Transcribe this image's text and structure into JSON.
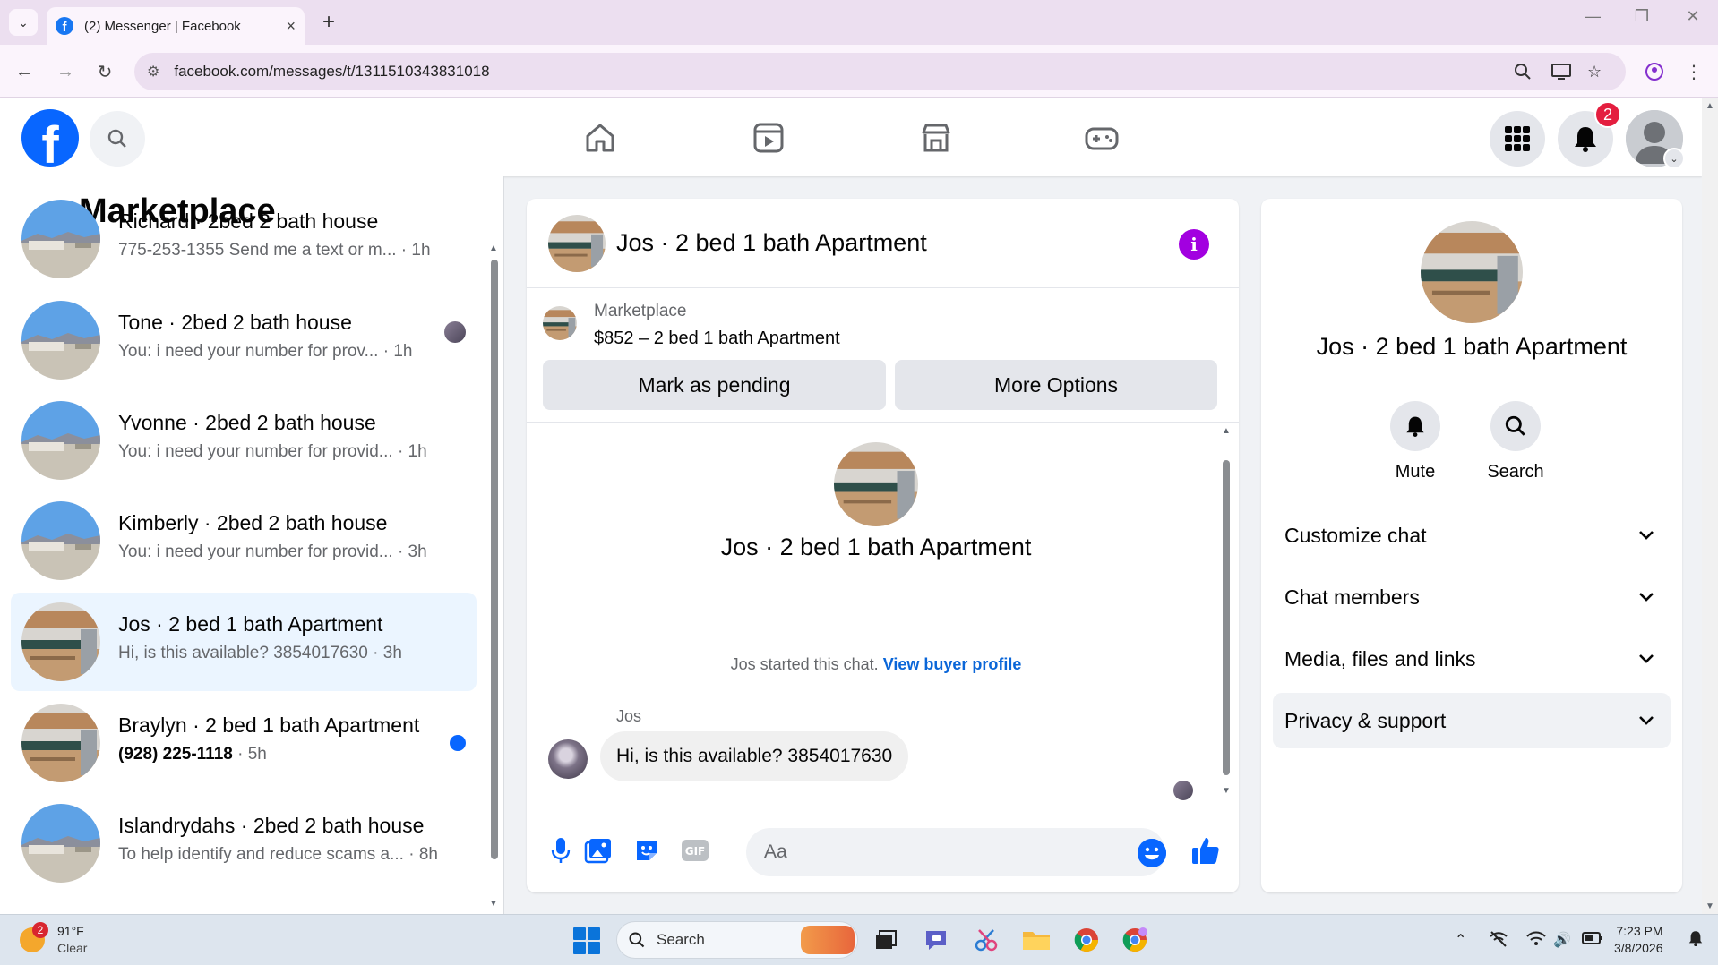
{
  "browser": {
    "tab_title": "(2) Messenger | Facebook",
    "url": "facebook.com/messages/t/1311510343831018"
  },
  "header": {
    "notification_count": "2"
  },
  "left": {
    "title": "Marketplace",
    "conversations": [
      {
        "name": "Richard · 2bed 2 bath house",
        "snippet": "775-253-1355 Send me a text or m...",
        "time": "· 1h",
        "state": "read"
      },
      {
        "name": "Tone · 2bed 2 bath house",
        "snippet": "You: i need your number for prov...",
        "time": "· 1h",
        "state": "seen"
      },
      {
        "name": "Yvonne · 2bed 2 bath house",
        "snippet": "You: i need your number for provid...",
        "time": "· 1h",
        "state": "read"
      },
      {
        "name": "Kimberly · 2bed 2 bath house",
        "snippet": "You: i need your number for provid...",
        "time": "· 3h",
        "state": "read"
      },
      {
        "name": "Jos · 2 bed 1 bath Apartment",
        "snippet": "Hi, is this available? 3854017630",
        "time": "· 3h",
        "state": "active"
      },
      {
        "name": "Braylyn · 2 bed 1 bath Apartment",
        "snippet": "(928) 225-1118",
        "time": "· 5h",
        "state": "unread"
      },
      {
        "name": "Islandrydahs · 2bed 2 bath house",
        "snippet": "To help identify and reduce scams a...",
        "time": "· 8h",
        "state": "read"
      }
    ]
  },
  "chat": {
    "title": "Jos · 2 bed 1 bath Apartment",
    "listing_source": "Marketplace",
    "listing_price_title": "$852 – 2 bed 1 bath Apartment",
    "mark_pending_label": "Mark as pending",
    "more_options_label": "More Options",
    "intro_title": "Jos · 2 bed 1 bath Apartment",
    "started_text": "Jos started this chat.",
    "view_profile_link": "View buyer profile",
    "sender_name": "Jos",
    "message": "Hi, is this available? 3854017630",
    "composer_placeholder": "Aa"
  },
  "details": {
    "title": "Jos · 2 bed 1 bath Apartment",
    "mute_label": "Mute",
    "search_label": "Search",
    "sections": [
      "Customize chat",
      "Chat members",
      "Media, files and links",
      "Privacy & support"
    ]
  },
  "taskbar": {
    "weather_badge": "2",
    "temperature": "91°F",
    "condition": "Clear",
    "search_label": "Search",
    "time": "7:23 PM",
    "date": "3/8/2026"
  },
  "colors": {
    "fb_blue": "#0866ff",
    "info_purple": "#a200e0",
    "active_row": "#ebf5ff"
  }
}
